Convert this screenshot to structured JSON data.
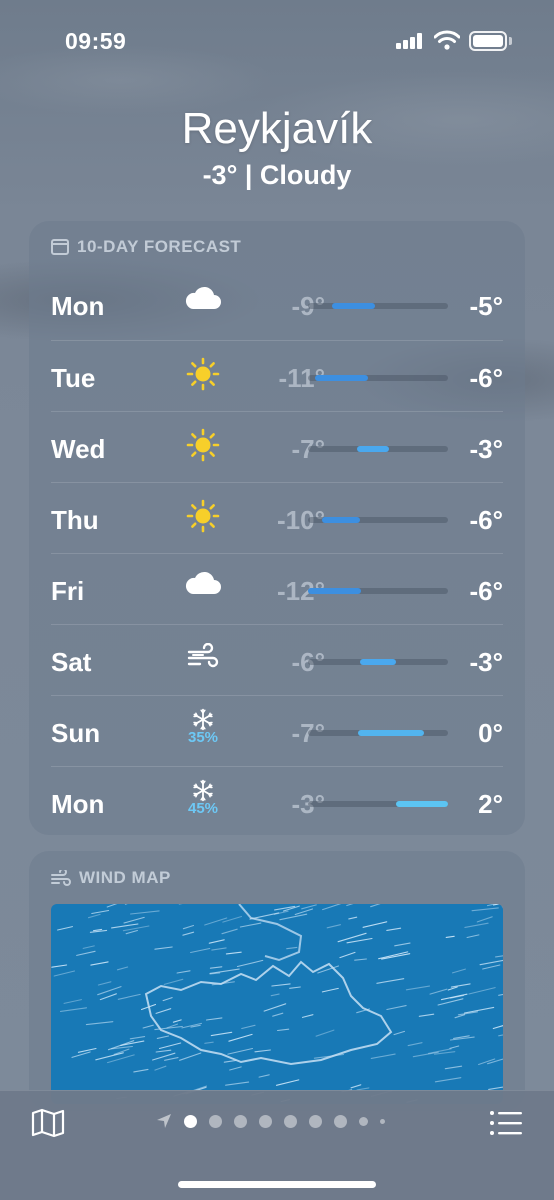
{
  "status_bar": {
    "time": "09:59"
  },
  "header": {
    "city": "Reykjavík",
    "summary": "-3° | Cloudy"
  },
  "forecast": {
    "title": "10-DAY FORECAST",
    "days": [
      {
        "day": "Mon",
        "icon": "cloud-icon",
        "precip": "",
        "low": "-9°",
        "high": "-5°",
        "range": [
          0.17,
          0.48
        ],
        "color": "#3d8fe0"
      },
      {
        "day": "Tue",
        "icon": "sun-icon",
        "precip": "",
        "low": "-11°",
        "high": "-6°",
        "range": [
          0.05,
          0.43
        ],
        "color": "#3d8fe0"
      },
      {
        "day": "Wed",
        "icon": "sun-icon",
        "precip": "",
        "low": "-7°",
        "high": "-3°",
        "range": [
          0.35,
          0.58
        ],
        "color": "#4aa8ee"
      },
      {
        "day": "Thu",
        "icon": "sun-icon",
        "precip": "",
        "low": "-10°",
        "high": "-6°",
        "range": [
          0.1,
          0.37
        ],
        "color": "#3d8fe0"
      },
      {
        "day": "Fri",
        "icon": "cloud-icon",
        "precip": "",
        "low": "-12°",
        "high": "-6°",
        "range": [
          0.0,
          0.38
        ],
        "color": "#3d8fe0"
      },
      {
        "day": "Sat",
        "icon": "wind-icon",
        "precip": "",
        "low": "-6°",
        "high": "-3°",
        "range": [
          0.37,
          0.63
        ],
        "color": "#4aa8ee"
      },
      {
        "day": "Sun",
        "icon": "snowflake-icon",
        "precip": "35%",
        "low": "-7°",
        "high": "0°",
        "range": [
          0.36,
          0.83
        ],
        "color": "#52b4ee"
      },
      {
        "day": "Mon",
        "icon": "snowflake-icon",
        "precip": "45%",
        "low": "-3°",
        "high": "2°",
        "range": [
          0.63,
          1.0
        ],
        "color": "#5cc4f2"
      }
    ]
  },
  "wind_map": {
    "title": "WIND MAP"
  },
  "colors": {
    "accent": "#6dc8f5",
    "map": "#1879b6"
  }
}
